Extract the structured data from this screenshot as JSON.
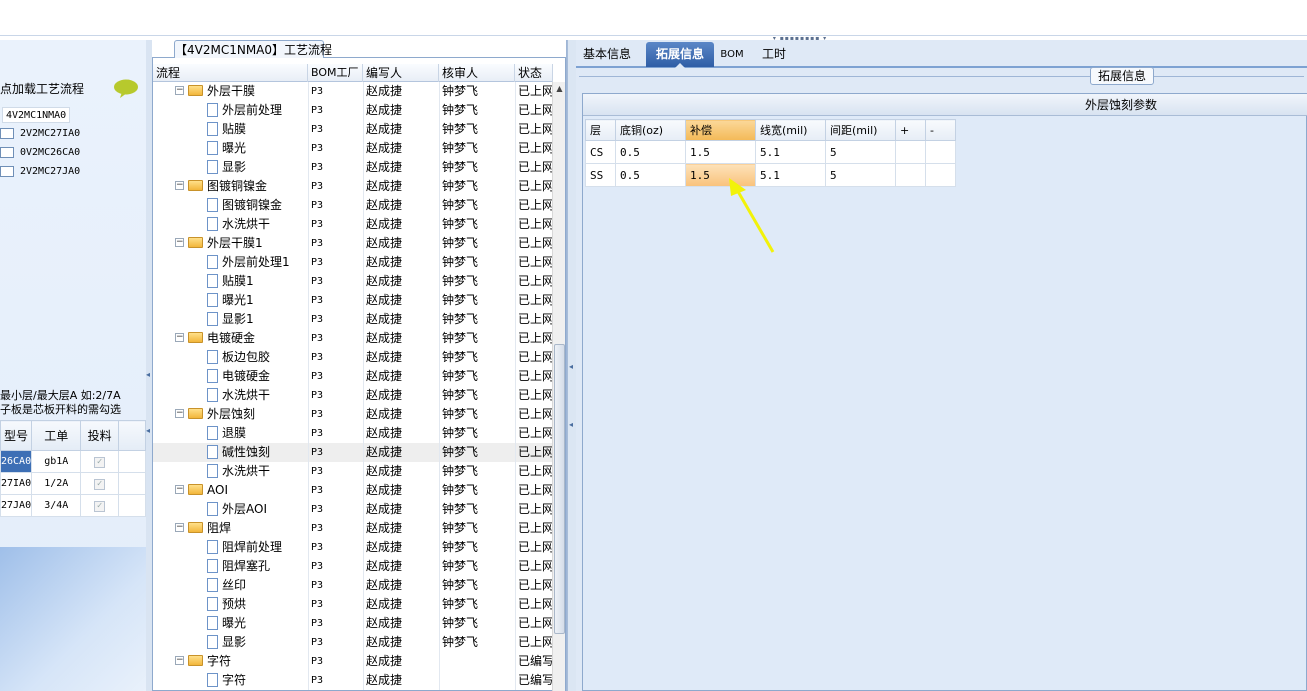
{
  "left_panel": {
    "header": "节点加载工艺流程",
    "root_node": "4V2MC1NMA0",
    "children": [
      "2V2MC27IA0",
      "0V2MC26CA0",
      "2V2MC27JA0"
    ],
    "note_line1": "最小层/最大层A 如:2/7A",
    "note_line2": "子板是芯板开料的需勾选",
    "table": {
      "columns": [
        "型号",
        "工单",
        "投料"
      ],
      "rows": [
        {
          "model": "26CA0",
          "order": "gb1A",
          "feed": true
        },
        {
          "model": "27IA0",
          "order": "1/2A",
          "feed": true
        },
        {
          "model": "27JA0",
          "order": "3/4A",
          "feed": true
        }
      ]
    }
  },
  "middle_panel": {
    "title": "【4V2MC1NMA0】工艺流程",
    "columns": [
      "流程",
      "BOM工厂",
      "编写人",
      "核审人",
      "状态"
    ],
    "rows": [
      {
        "name": "外层干膜",
        "type": "group",
        "bom": "P3",
        "writer": "赵成捷",
        "reviewer": "钟梦飞",
        "status": "已上网"
      },
      {
        "name": "外层前处理",
        "type": "item",
        "bom": "P3",
        "writer": "赵成捷",
        "reviewer": "钟梦飞",
        "status": "已上网"
      },
      {
        "name": "贴膜",
        "type": "item",
        "bom": "P3",
        "writer": "赵成捷",
        "reviewer": "钟梦飞",
        "status": "已上网"
      },
      {
        "name": "曝光",
        "type": "item",
        "bom": "P3",
        "writer": "赵成捷",
        "reviewer": "钟梦飞",
        "status": "已上网"
      },
      {
        "name": "显影",
        "type": "item",
        "bom": "P3",
        "writer": "赵成捷",
        "reviewer": "钟梦飞",
        "status": "已上网"
      },
      {
        "name": "图镀铜镍金",
        "type": "group",
        "bom": "P3",
        "writer": "赵成捷",
        "reviewer": "钟梦飞",
        "status": "已上网"
      },
      {
        "name": "图镀铜镍金",
        "type": "item",
        "bom": "P3",
        "writer": "赵成捷",
        "reviewer": "钟梦飞",
        "status": "已上网"
      },
      {
        "name": "水洗烘干",
        "type": "item",
        "bom": "P3",
        "writer": "赵成捷",
        "reviewer": "钟梦飞",
        "status": "已上网"
      },
      {
        "name": "外层干膜1",
        "type": "group",
        "bom": "P3",
        "writer": "赵成捷",
        "reviewer": "钟梦飞",
        "status": "已上网"
      },
      {
        "name": "外层前处理1",
        "type": "item",
        "bom": "P3",
        "writer": "赵成捷",
        "reviewer": "钟梦飞",
        "status": "已上网"
      },
      {
        "name": "贴膜1",
        "type": "item",
        "bom": "P3",
        "writer": "赵成捷",
        "reviewer": "钟梦飞",
        "status": "已上网"
      },
      {
        "name": "曝光1",
        "type": "item",
        "bom": "P3",
        "writer": "赵成捷",
        "reviewer": "钟梦飞",
        "status": "已上网"
      },
      {
        "name": "显影1",
        "type": "item",
        "bom": "P3",
        "writer": "赵成捷",
        "reviewer": "钟梦飞",
        "status": "已上网"
      },
      {
        "name": "电镀硬金",
        "type": "group",
        "bom": "P3",
        "writer": "赵成捷",
        "reviewer": "钟梦飞",
        "status": "已上网"
      },
      {
        "name": "板边包胶",
        "type": "item",
        "bom": "P3",
        "writer": "赵成捷",
        "reviewer": "钟梦飞",
        "status": "已上网"
      },
      {
        "name": "电镀硬金",
        "type": "item",
        "bom": "P3",
        "writer": "赵成捷",
        "reviewer": "钟梦飞",
        "status": "已上网"
      },
      {
        "name": "水洗烘干",
        "type": "item",
        "bom": "P3",
        "writer": "赵成捷",
        "reviewer": "钟梦飞",
        "status": "已上网"
      },
      {
        "name": "外层蚀刻",
        "type": "group",
        "bom": "P3",
        "writer": "赵成捷",
        "reviewer": "钟梦飞",
        "status": "已上网"
      },
      {
        "name": "退膜",
        "type": "item",
        "bom": "P3",
        "writer": "赵成捷",
        "reviewer": "钟梦飞",
        "status": "已上网"
      },
      {
        "name": "碱性蚀刻",
        "type": "item",
        "bom": "P3",
        "writer": "赵成捷",
        "reviewer": "钟梦飞",
        "status": "已上网",
        "selected": true
      },
      {
        "name": "水洗烘干",
        "type": "item",
        "bom": "P3",
        "writer": "赵成捷",
        "reviewer": "钟梦飞",
        "status": "已上网"
      },
      {
        "name": "AOI",
        "type": "group",
        "bom": "P3",
        "writer": "赵成捷",
        "reviewer": "钟梦飞",
        "status": "已上网"
      },
      {
        "name": "外层AOI",
        "type": "item",
        "bom": "P3",
        "writer": "赵成捷",
        "reviewer": "钟梦飞",
        "status": "已上网"
      },
      {
        "name": "阻焊",
        "type": "group",
        "bom": "P3",
        "writer": "赵成捷",
        "reviewer": "钟梦飞",
        "status": "已上网"
      },
      {
        "name": "阻焊前处理",
        "type": "item",
        "bom": "P3",
        "writer": "赵成捷",
        "reviewer": "钟梦飞",
        "status": "已上网"
      },
      {
        "name": "阻焊塞孔",
        "type": "item",
        "bom": "P3",
        "writer": "赵成捷",
        "reviewer": "钟梦飞",
        "status": "已上网"
      },
      {
        "name": "丝印",
        "type": "item",
        "bom": "P3",
        "writer": "赵成捷",
        "reviewer": "钟梦飞",
        "status": "已上网"
      },
      {
        "name": "预烘",
        "type": "item",
        "bom": "P3",
        "writer": "赵成捷",
        "reviewer": "钟梦飞",
        "status": "已上网"
      },
      {
        "name": "曝光",
        "type": "item",
        "bom": "P3",
        "writer": "赵成捷",
        "reviewer": "钟梦飞",
        "status": "已上网"
      },
      {
        "name": "显影",
        "type": "item",
        "bom": "P3",
        "writer": "赵成捷",
        "reviewer": "钟梦飞",
        "status": "已上网"
      },
      {
        "name": "字符",
        "type": "group",
        "bom": "P3",
        "writer": "赵成捷",
        "reviewer": "",
        "status": "已编写"
      },
      {
        "name": "字符",
        "type": "item",
        "bom": "P3",
        "writer": "赵成捷",
        "reviewer": "",
        "status": "已编写"
      }
    ]
  },
  "right_panel": {
    "tabs": [
      "基本信息",
      "拓展信息",
      "BOM",
      "工时"
    ],
    "active_tab": 1,
    "ext_label": "拓展信息",
    "group_title": "外层蚀刻参数",
    "table": {
      "columns": [
        "层",
        "底铜(oz)",
        "补偿",
        "线宽(mil)",
        "间距(mil)",
        "+",
        "-"
      ],
      "rows": [
        [
          "CS",
          "0.5",
          "1.5",
          "5.1",
          "5",
          "",
          ""
        ],
        [
          "SS",
          "0.5",
          "1.5",
          "5.1",
          "5",
          "",
          ""
        ]
      ]
    }
  },
  "colors": {
    "accent": "#2f5ea6",
    "highlight": "#f3b957",
    "annotation_arrow": "#f2f20a"
  }
}
